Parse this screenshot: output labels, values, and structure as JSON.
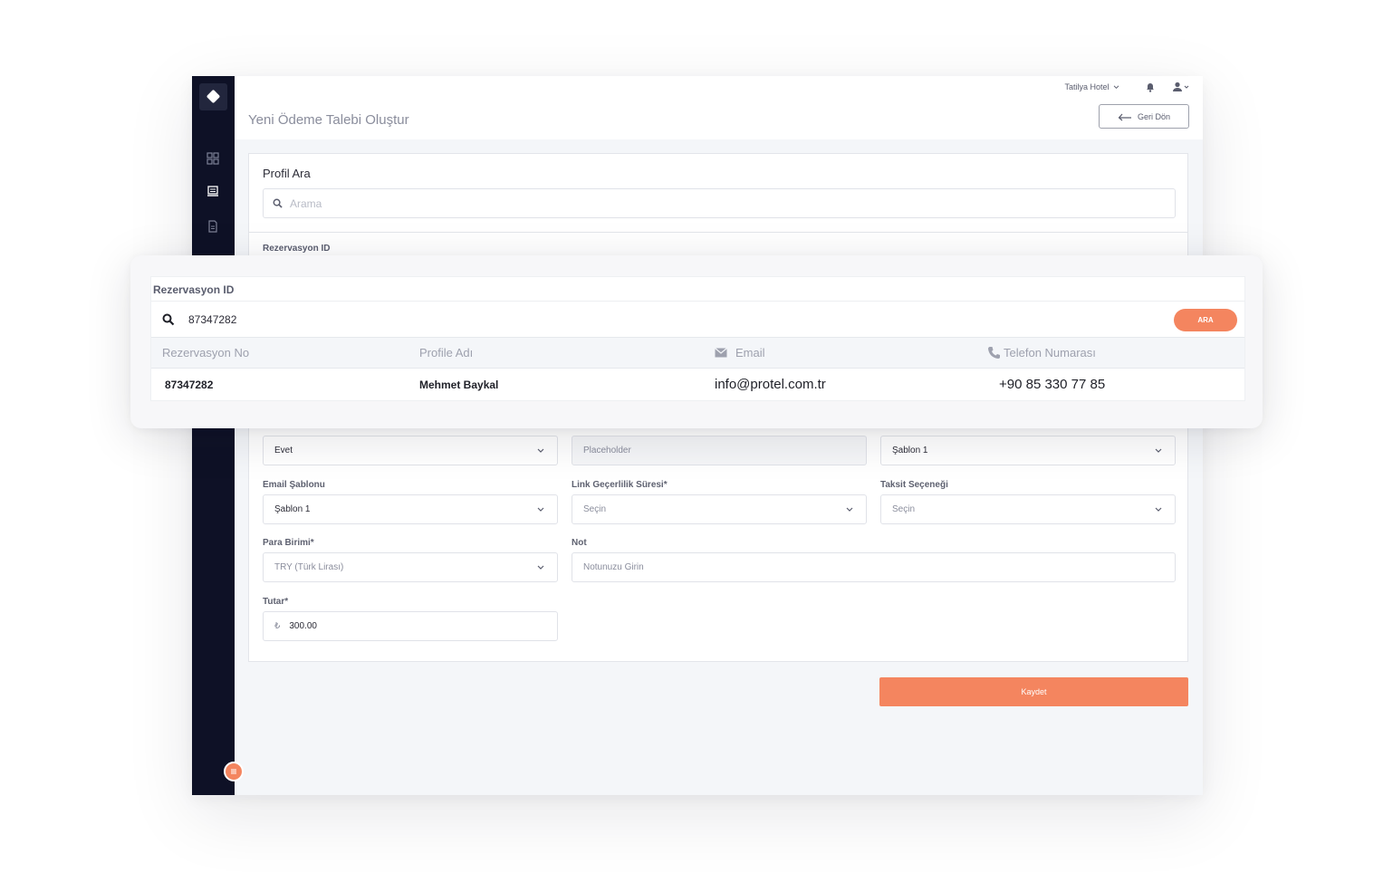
{
  "header": {
    "hotel_selector": "Tatilya Hotel",
    "page_title": "Yeni Ödeme Talebi Oluştur",
    "back_button": "Geri Dön"
  },
  "profile_search": {
    "title": "Profil Ara",
    "placeholder": "Arama",
    "reservation_label": "Rezervasyon ID"
  },
  "form": {
    "row1": {
      "col1_value": "Evet",
      "col2_placeholder": "Placeholder",
      "col3_value": "Şablon 1"
    },
    "email_template": {
      "label": "Email Şablonu",
      "value": "Şablon 1"
    },
    "link_validity": {
      "label": "Link Geçerlilik Süresi*",
      "value": "Seçin"
    },
    "installment": {
      "label": "Taksit Seçeneği",
      "value": "Seçin"
    },
    "currency": {
      "label": "Para Birimi*",
      "value": "TRY (Türk Lirası)"
    },
    "note": {
      "label": "Not",
      "placeholder": "Notunuzu Girin"
    },
    "amount": {
      "label": "Tutar*",
      "currency_symbol": "₺",
      "value": "300.00"
    },
    "save_button": "Kaydet"
  },
  "overlay": {
    "title": "Rezervasyon ID",
    "search_value": "87347282",
    "search_button": "ARA",
    "columns": [
      "Rezervasyon No",
      "Profile Adı",
      "Email",
      "Telefon Numarası"
    ],
    "row": {
      "reservation_no": "87347282",
      "profile_name": "Mehmet Baykal",
      "email": "info@protel.com.tr",
      "phone": "+90 85 330 77 85"
    }
  },
  "colors": {
    "accent": "#f4855f",
    "sidebar": "#0e1126",
    "background": "#f4f6f9"
  },
  "icons": [
    "logo-icon",
    "dashboard-icon",
    "inbox-icon",
    "document-icon",
    "bell-icon",
    "user-icon",
    "search-icon",
    "back-arrow-icon",
    "mail-icon",
    "phone-icon",
    "chevron-down-icon",
    "menu-icon"
  ]
}
